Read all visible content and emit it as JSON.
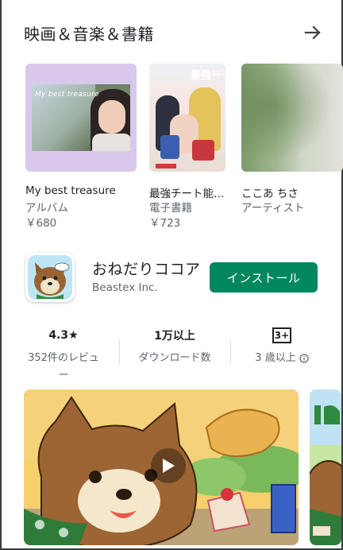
{
  "section": {
    "title": "映画＆音楽＆書籍",
    "more_icon": "arrow-right-icon"
  },
  "cards": [
    {
      "title": "My best treasure",
      "type": "アルバム",
      "price": "￥680",
      "cover_text": "My best treasure"
    },
    {
      "title": "最強チート能…",
      "type": "電子書籍",
      "price": "￥723",
      "cover_text": "最強チート"
    },
    {
      "title": "ここあ ちさ",
      "type": "アーティスト",
      "price": ""
    }
  ],
  "app": {
    "name": "おねだりココア",
    "developer": "Beastex Inc.",
    "install_label": "インストール",
    "install_color": "#01875f"
  },
  "stats": {
    "rating": "4.3★",
    "reviews_line1": "352件のレビュ",
    "reviews_line2": "ー",
    "downloads": "1万以上",
    "downloads_label": "ダウンロード数",
    "age_badge": "3+",
    "age_label": "3 歳以上",
    "info_icon": "info-icon"
  },
  "screenshots": {
    "play_icon": "play-icon"
  }
}
